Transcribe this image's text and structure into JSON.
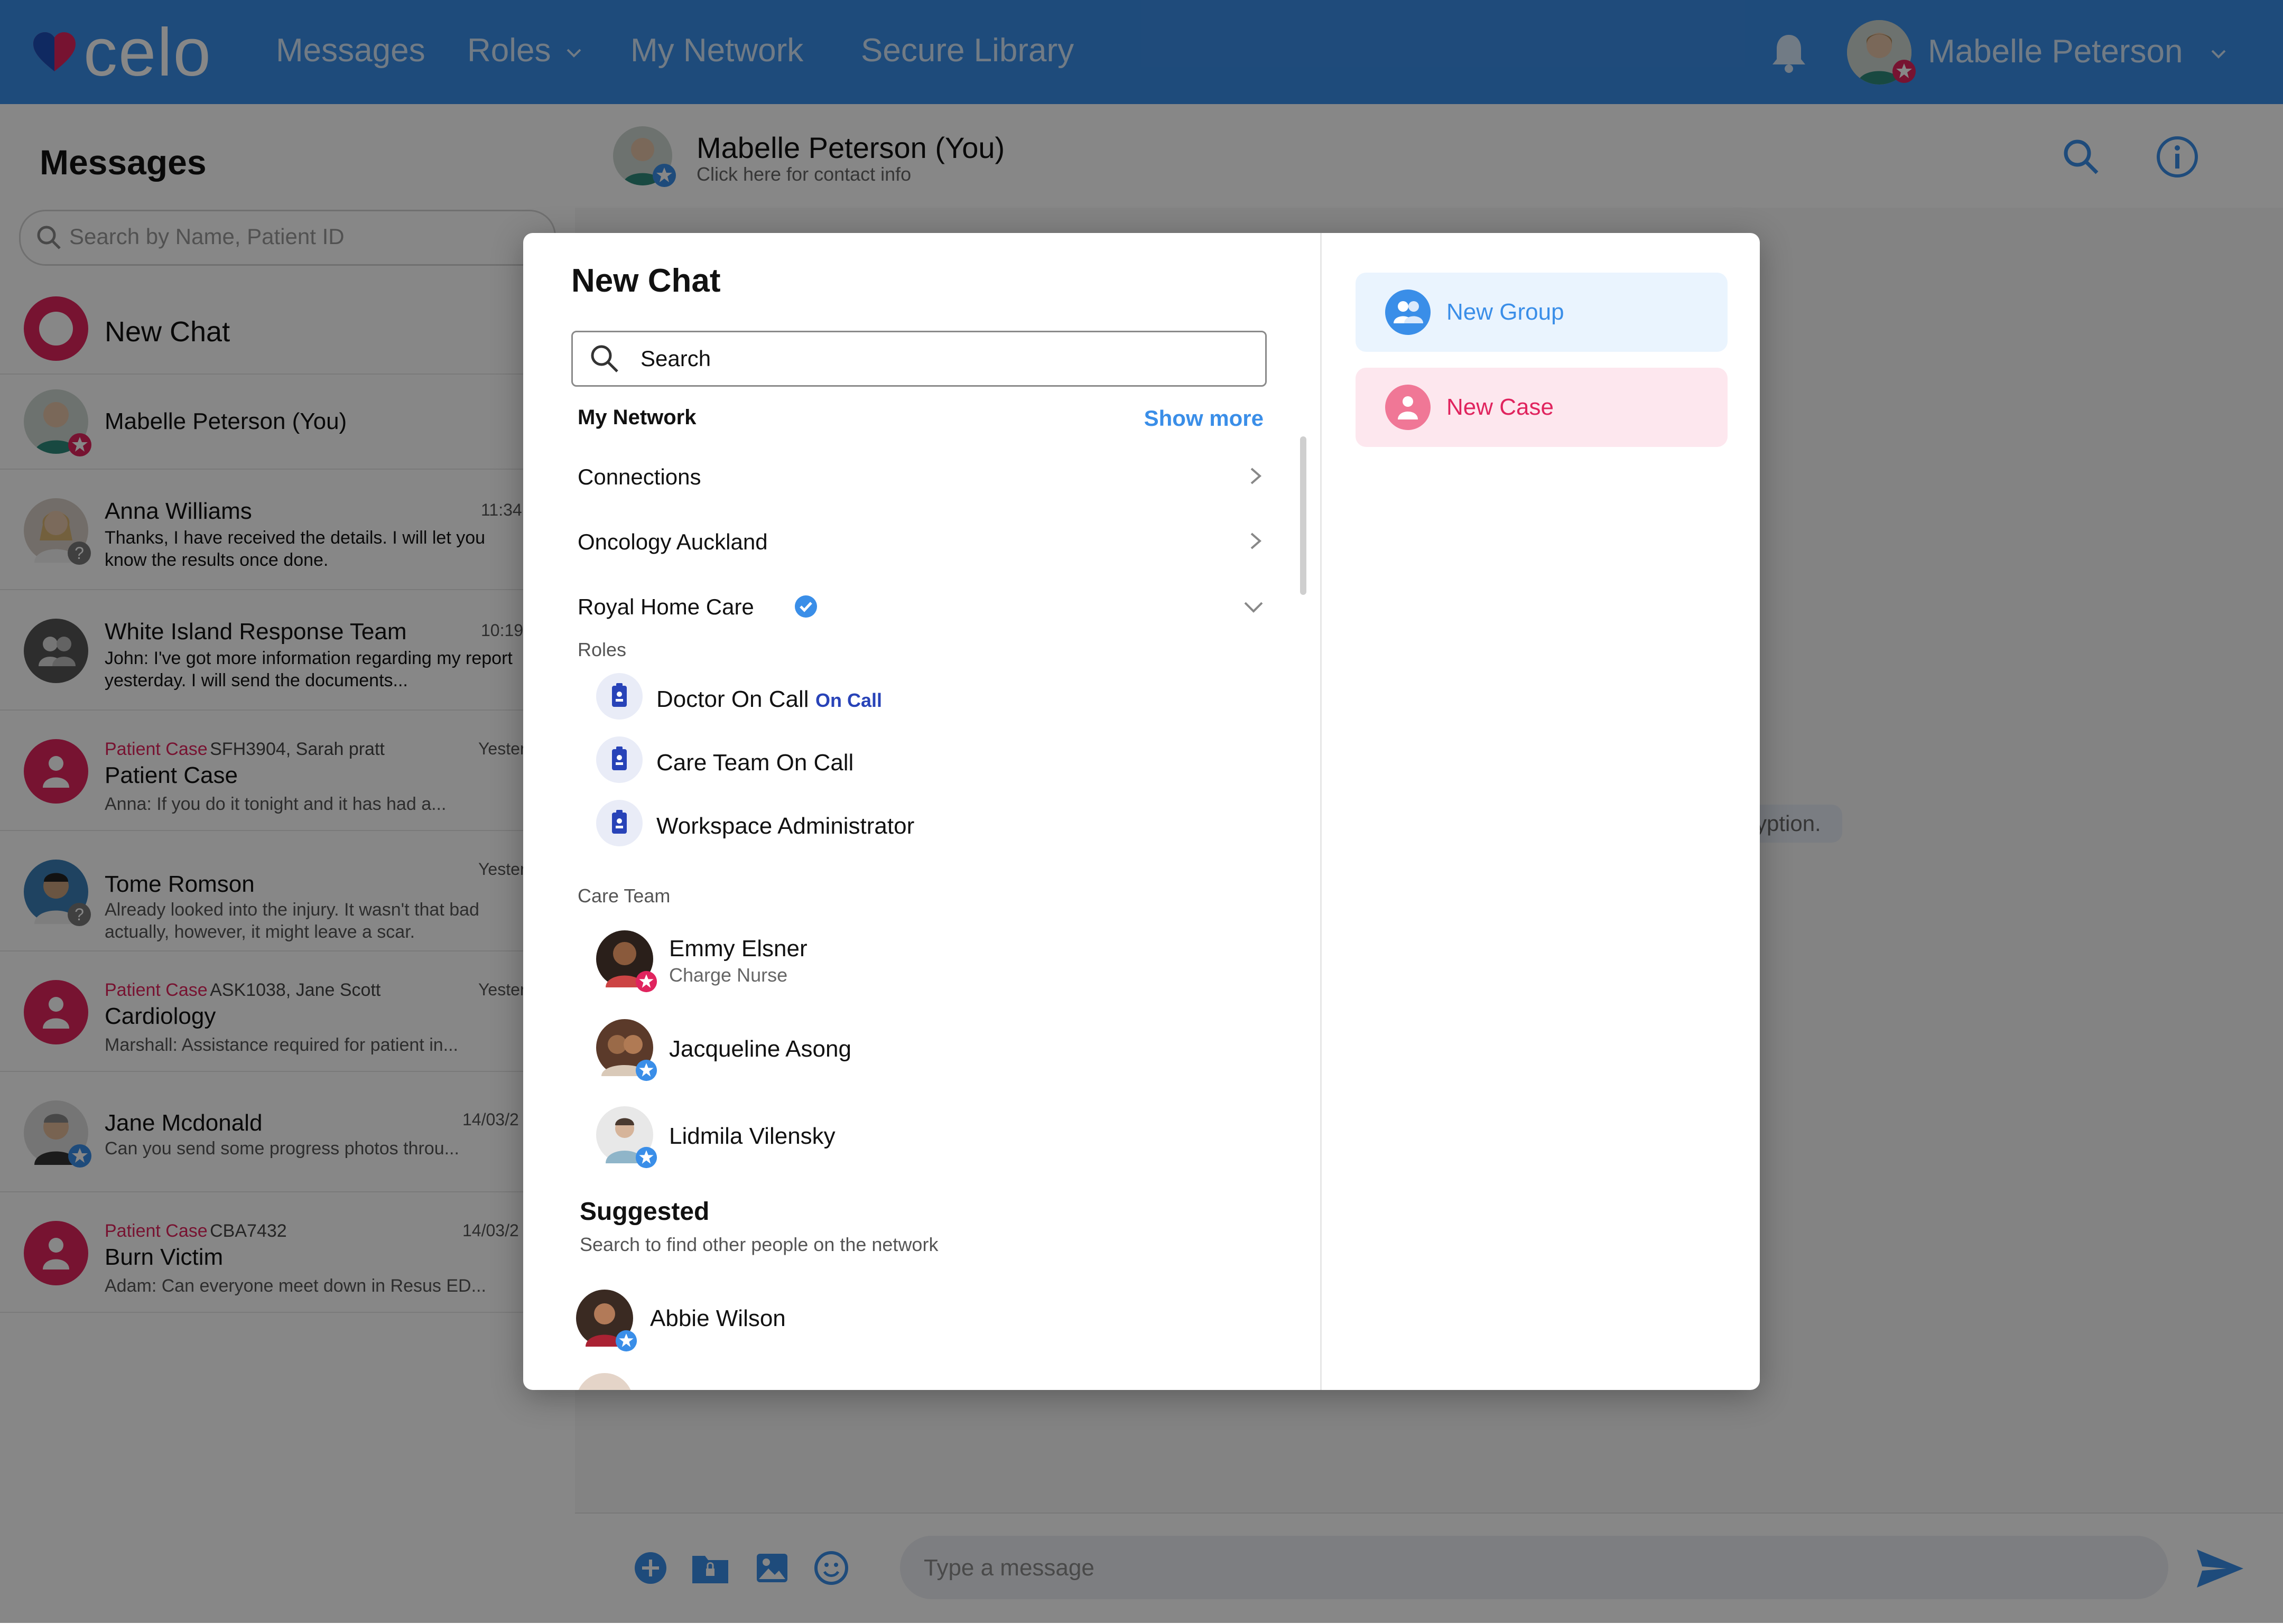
{
  "colors": {
    "brand_blue": "#3a8ee8",
    "nav_text": "#d6e8fb",
    "patient_case_red": "#e0245e",
    "on_call_blue": "#2843b8",
    "new_group_bg": "#eaf4fe",
    "new_case_bg": "#fde7ee"
  },
  "topnav": {
    "logo_text": "celo",
    "links": [
      "Messages",
      "Roles",
      "My Network",
      "Secure Library"
    ],
    "user_name": "Mabelle Peterson",
    "icons": [
      "bell-icon",
      "chevron-down-icon"
    ]
  },
  "sidebar": {
    "title": "Messages",
    "search_placeholder": "Search by Name, Patient ID",
    "new_chat_label": "New Chat",
    "self_name": "Mabelle Peterson (You)",
    "conversations": [
      {
        "name": "Anna Williams",
        "time": "11:34",
        "message": "Thanks, I have received the details. I will let you know the results once done."
      },
      {
        "name": "White Island Response Team",
        "time": "10:19",
        "message": "John: I've got more information regarding my report yesterday. I will send the documents..."
      },
      {
        "case_label": "Patient Case",
        "case_meta": "SFH3904, Sarah pratt",
        "name": "Patient Case",
        "time": "Yester",
        "message": "Anna: If you do it tonight and it has had a..."
      },
      {
        "name": "Tome Romson",
        "time": "Yester",
        "message": "Already looked into the injury. It wasn't that bad actually, however, it might leave a scar."
      },
      {
        "case_label": "Patient Case",
        "case_meta": "ASK1038, Jane Scott",
        "name": "Cardiology",
        "time": "Yester",
        "message": "Marshall: Assistance required for patient in..."
      },
      {
        "name": "Jane Mcdonald",
        "time": "14/03/2",
        "message": "Can you send some progress photos throu..."
      },
      {
        "case_label": "Patient Case",
        "case_meta": "CBA7432",
        "name": "Burn Victim",
        "time": "14/03/2",
        "message": "Adam: Can everyone meet down in Resus ED..."
      }
    ]
  },
  "chat": {
    "contact_name": "Mabelle Peterson (You)",
    "contact_sub": "Click here for contact info",
    "system_text_fragment": "ryption.",
    "input_placeholder": "Type a message"
  },
  "modal": {
    "title": "New Chat",
    "search_placeholder": "Search",
    "my_network_label": "My Network",
    "show_more": "Show more",
    "network_rows": [
      "Connections",
      "Oncology Auckland",
      "Royal Home Care"
    ],
    "roles_label": "Roles",
    "roles": [
      {
        "name": "Doctor On Call",
        "badge": "On Call"
      },
      {
        "name": "Care Team On Call",
        "badge": ""
      },
      {
        "name": "Workspace Administrator",
        "badge": ""
      }
    ],
    "care_team_label": "Care Team",
    "care_team": [
      {
        "name": "Emmy Elsner",
        "role": "Charge Nurse"
      },
      {
        "name": "Jacqueline Asong",
        "role": ""
      },
      {
        "name": "Lidmila Vilensky",
        "role": ""
      }
    ],
    "suggested_label": "Suggested",
    "suggested_sub": "Search to find other people on the network",
    "suggested": [
      {
        "name": "Abbie Wilson"
      }
    ],
    "actions": [
      {
        "label": "New Group",
        "color": "#3a8ee8"
      },
      {
        "label": "New Case",
        "color": "#e0245e"
      }
    ]
  }
}
